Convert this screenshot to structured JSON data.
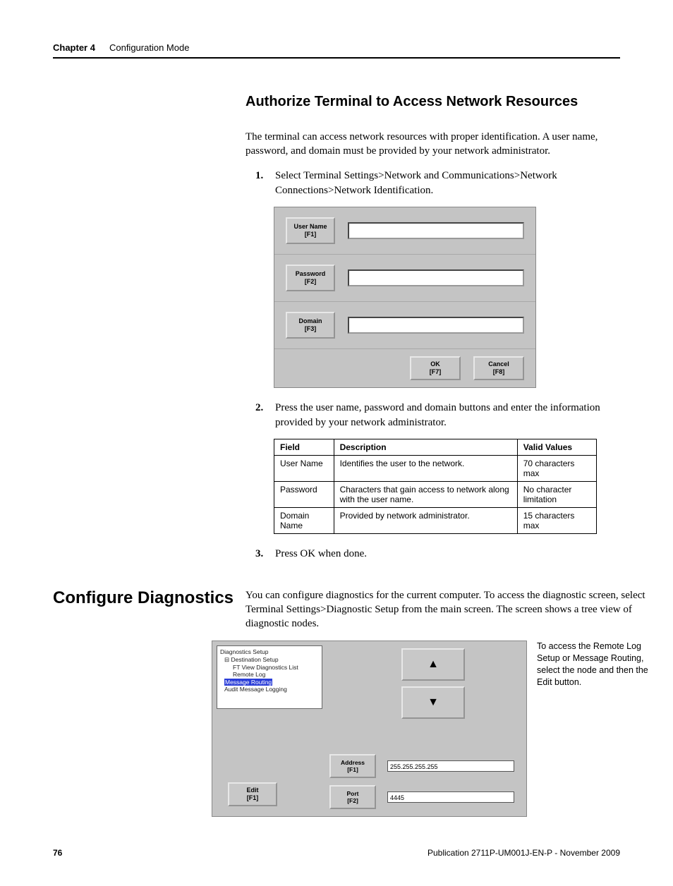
{
  "header": {
    "chapter": "Chapter 4",
    "title": "Configuration Mode"
  },
  "section1": {
    "heading": "Authorize Terminal to Access Network Resources",
    "intro": "The terminal can access network resources with proper identification. A user name, password, and domain must be provided by your network administrator.",
    "steps": {
      "s1": "Select Terminal Settings>Network and Communications>Network Connections>Network Identification.",
      "s2": "Press the user name, password and domain buttons and enter the information provided by your network administrator.",
      "s3": "Press OK when done."
    },
    "dialog": {
      "user": "User Name",
      "user_key": "[F1]",
      "pass": "Password",
      "pass_key": "[F2]",
      "domain": "Domain",
      "domain_key": "[F3]",
      "ok": "OK",
      "ok_key": "[F7]",
      "cancel": "Cancel",
      "cancel_key": "[F8]"
    },
    "table": {
      "h1": "Field",
      "h2": "Description",
      "h3": "Valid Values",
      "rows": [
        {
          "f": "User Name",
          "d": "Identifies the user to the network.",
          "v": "70 characters max"
        },
        {
          "f": "Password",
          "d": "Characters that gain access to network along with the user name.",
          "v": "No character limitation"
        },
        {
          "f": "Domain Name",
          "d": "Provided by network administrator.",
          "v": "15 characters max"
        }
      ]
    }
  },
  "section2": {
    "side_heading": "Configure Diagnostics",
    "intro": "You can configure diagnostics for the current computer. To access the diagnostic screen, select Terminal Settings>Diagnostic Setup from the main screen. The screen shows a tree view of diagnostic nodes.",
    "side_note": "To access the Remote Log Setup or Message Routing, select the node and then the Edit button.",
    "tree": {
      "root": "Diagnostics Setup",
      "n1": "Destination Setup",
      "n2": "FT View Diagnostics List",
      "n3": "Remote Log",
      "n4": "Message Routing",
      "n5": "Audit Message Logging"
    },
    "edit": "Edit",
    "edit_key": "[F1]",
    "address": "Address",
    "address_key": "[F1]",
    "address_val": "255.255.255.255",
    "port": "Port",
    "port_key": "[F2]",
    "port_val": "4445"
  },
  "footer": {
    "page": "76",
    "pub": "Publication 2711P-UM001J-EN-P - November 2009"
  }
}
